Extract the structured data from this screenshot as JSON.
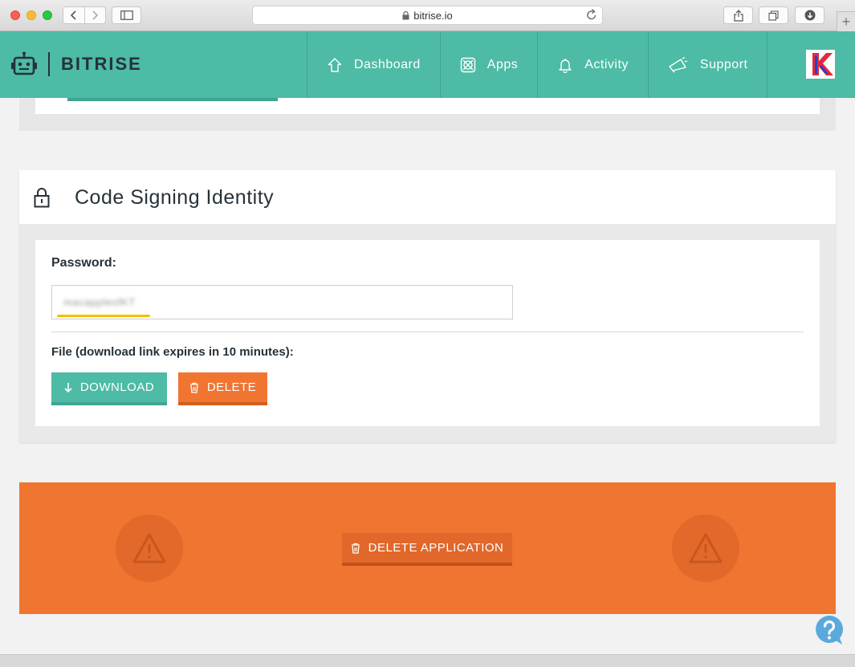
{
  "browser": {
    "url": "bitrise.io",
    "new_tab": "+"
  },
  "header": {
    "brand": "BITRISE",
    "nav": [
      {
        "label": "Dashboard",
        "icon": "home-icon"
      },
      {
        "label": "Apps",
        "icon": "apps-icon"
      },
      {
        "label": "Activity",
        "icon": "bell-icon"
      },
      {
        "label": "Support",
        "icon": "megaphone-icon"
      }
    ],
    "avatar_letter": "K"
  },
  "code_signing": {
    "title": "Code Signing Identity",
    "password_label": "Password:",
    "password_value": "macappleofKT",
    "file_label": "File (download link expires in 10 minutes):",
    "download_label": "DOWNLOAD",
    "delete_label": "DELETE"
  },
  "danger_zone": {
    "delete_app_label": "DELETE APPLICATION"
  },
  "colors": {
    "teal": "#4dbba5",
    "orange": "#f07531",
    "dark": "#26323a"
  }
}
